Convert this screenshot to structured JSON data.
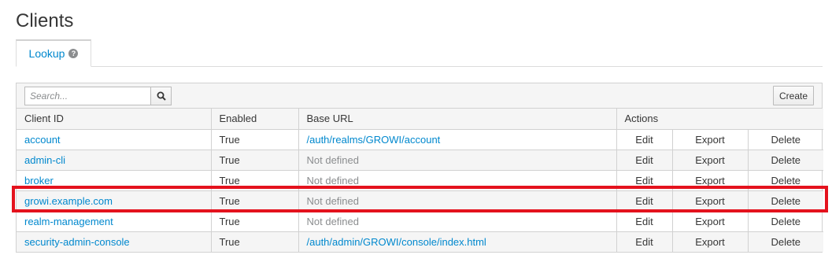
{
  "page": {
    "title": "Clients"
  },
  "tabs": [
    {
      "label": "Lookup",
      "help_icon": "question-circle-icon"
    }
  ],
  "toolbar": {
    "search_placeholder": "Search...",
    "search_icon": "search-icon",
    "create_label": "Create"
  },
  "table": {
    "headers": {
      "client_id": "Client ID",
      "enabled": "Enabled",
      "base_url": "Base URL",
      "actions": "Actions"
    },
    "rows": [
      {
        "client_id": "account",
        "enabled": "True",
        "base_url": "/auth/realms/GROWI/account",
        "base_url_defined": true,
        "edit": "Edit",
        "export": "Export",
        "delete": "Delete"
      },
      {
        "client_id": "admin-cli",
        "enabled": "True",
        "base_url": "Not defined",
        "base_url_defined": false,
        "edit": "Edit",
        "export": "Export",
        "delete": "Delete"
      },
      {
        "client_id": "broker",
        "enabled": "True",
        "base_url": "Not defined",
        "base_url_defined": false,
        "edit": "Edit",
        "export": "Export",
        "delete": "Delete"
      },
      {
        "client_id": "growi.example.com",
        "enabled": "True",
        "base_url": "Not defined",
        "base_url_defined": false,
        "edit": "Edit",
        "export": "Export",
        "delete": "Delete",
        "highlighted": true
      },
      {
        "client_id": "realm-management",
        "enabled": "True",
        "base_url": "Not defined",
        "base_url_defined": false,
        "edit": "Edit",
        "export": "Export",
        "delete": "Delete"
      },
      {
        "client_id": "security-admin-console",
        "enabled": "True",
        "base_url": "/auth/admin/GROWI/console/index.html",
        "base_url_defined": true,
        "edit": "Edit",
        "export": "Export",
        "delete": "Delete"
      }
    ]
  },
  "colors": {
    "link": "#0088ce",
    "muted": "#8b8d8f",
    "highlight_border": "#e4121d"
  }
}
